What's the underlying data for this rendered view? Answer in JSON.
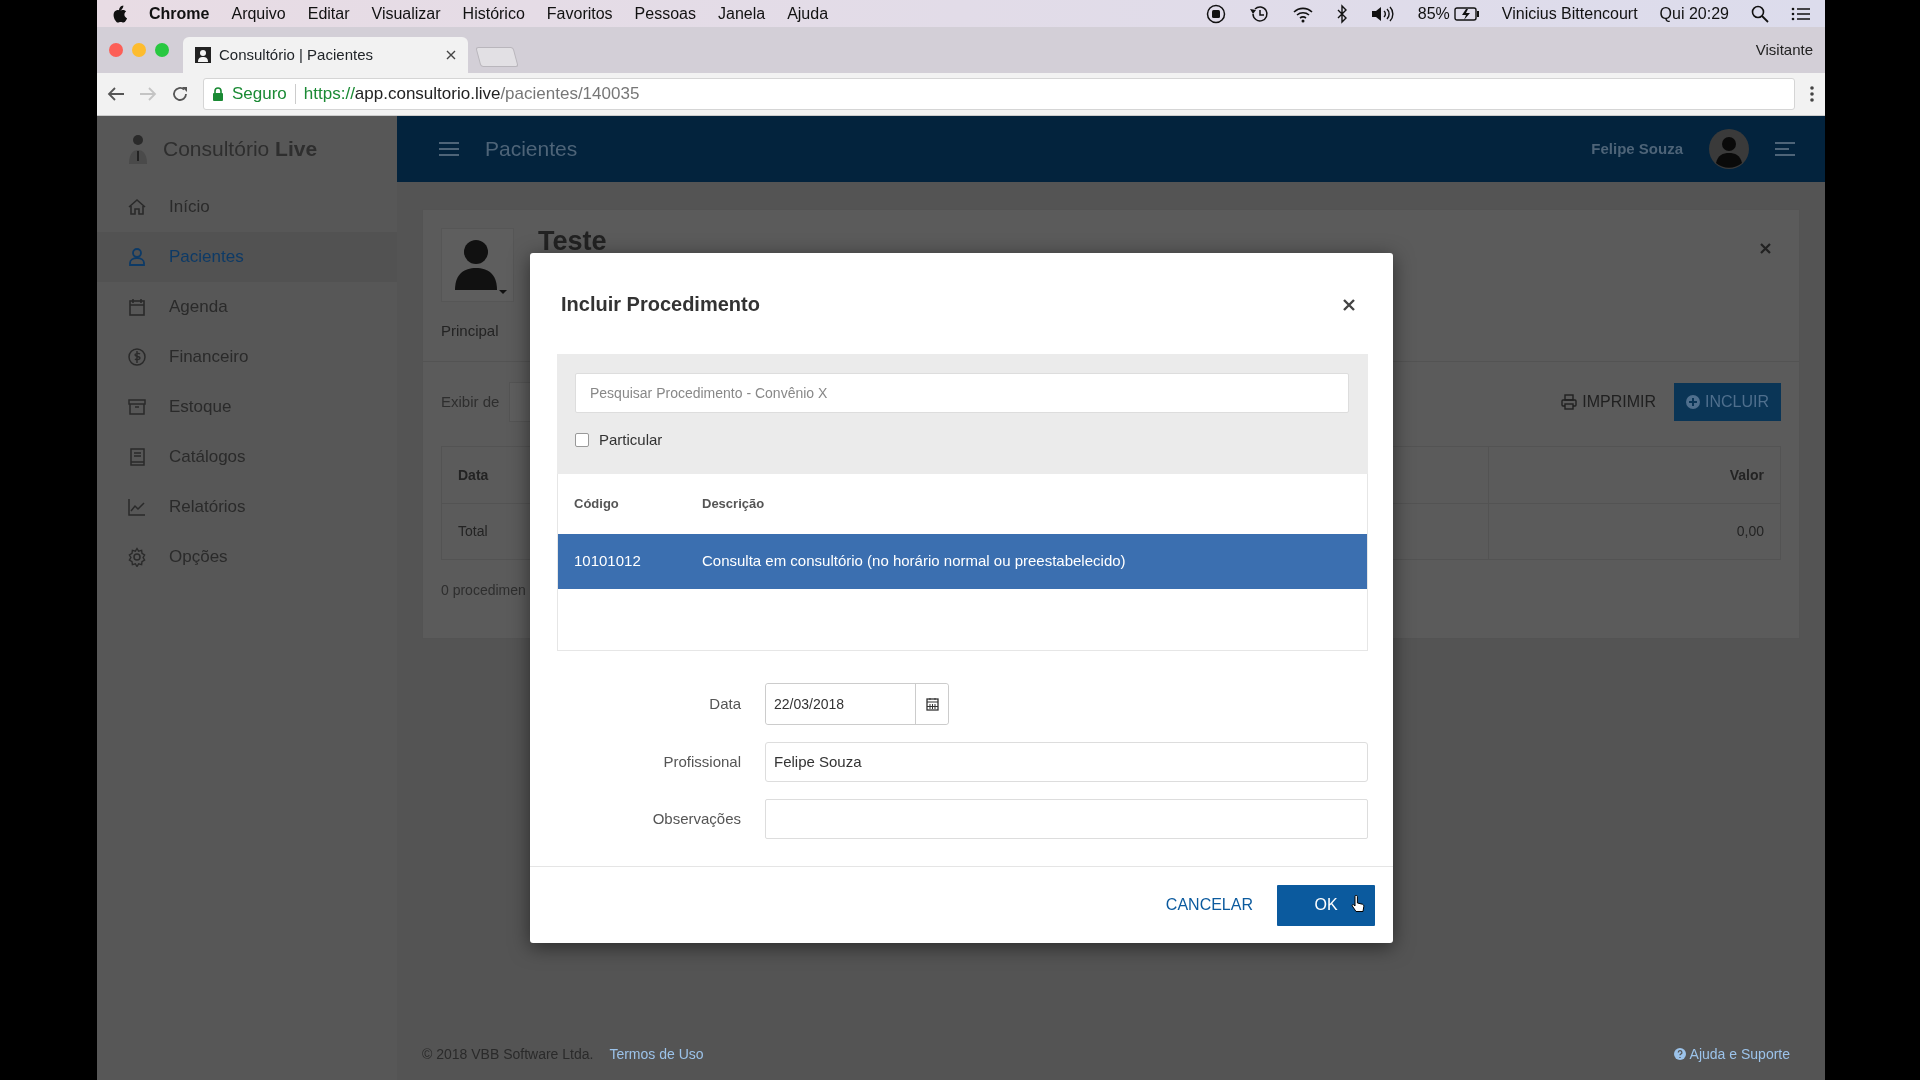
{
  "menu_bar": {
    "app": "Chrome",
    "items": [
      "Arquivo",
      "Editar",
      "Visualizar",
      "Histórico",
      "Favoritos",
      "Pessoas",
      "Janela",
      "Ajuda"
    ],
    "battery": "85%",
    "user": "Vinicius Bittencourt",
    "clock": "Qui 20:29"
  },
  "browser": {
    "tab": {
      "title": "Consultório | Pacientes"
    },
    "profile": "Visitante",
    "security": "Seguro",
    "url": {
      "scheme": "https://",
      "host": "app.consultorio.live",
      "path": "/pacientes/140035"
    }
  },
  "app": {
    "brand": "Consultório **Live**",
    "sidebar": {
      "items": [
        {
          "label": "Início",
          "selected": false
        },
        {
          "label": "Pacientes",
          "selected": true
        },
        {
          "label": "Agenda",
          "selected": false
        },
        {
          "label": "Financeiro",
          "selected": false
        },
        {
          "label": "Estoque",
          "selected": false
        },
        {
          "label": "Catálogos",
          "selected": false
        },
        {
          "label": "Relatórios",
          "selected": false
        },
        {
          "label": "Opções",
          "selected": false
        }
      ]
    },
    "header": {
      "title": "Pacientes",
      "user": "Felipe Souza"
    },
    "patient": {
      "name": "Teste",
      "tab": "Principal",
      "filter_label": "Exibir de",
      "buttons": [
        "IMPRIMIR",
        "INCLUIR"
      ],
      "table": {
        "columns": [
          "Data",
          "Valor"
        ],
        "rows": [
          [
            "Total",
            "0,00"
          ]
        ]
      },
      "summary": "0 procedimen"
    },
    "footer": {
      "copyright": "© 2018 VBB Software Ltda.",
      "terms": "Termos de Uso",
      "help": "Ajuda e Suporte"
    }
  },
  "modal": {
    "title": "Incluir Procedimento",
    "search": {
      "placeholder": "Pesquisar Procedimento - Convênio X"
    },
    "particular": {
      "label": "Particular",
      "checked": false
    },
    "table": {
      "columns": [
        "Código",
        "Descrição"
      ],
      "rows": [
        {
          "code": "10101012",
          "description": "Consulta em consultório (no horário normal ou preestabelecido)",
          "selected": true
        }
      ]
    },
    "fields": [
      {
        "kind": "date",
        "label": "Data",
        "value": "22/03/2018"
      },
      {
        "kind": "select",
        "label": "Profissional",
        "value": "Felipe Souza"
      },
      {
        "kind": "text",
        "label": "Observações"
      }
    ],
    "cancel": "CANCELAR",
    "ok": "OK"
  }
}
